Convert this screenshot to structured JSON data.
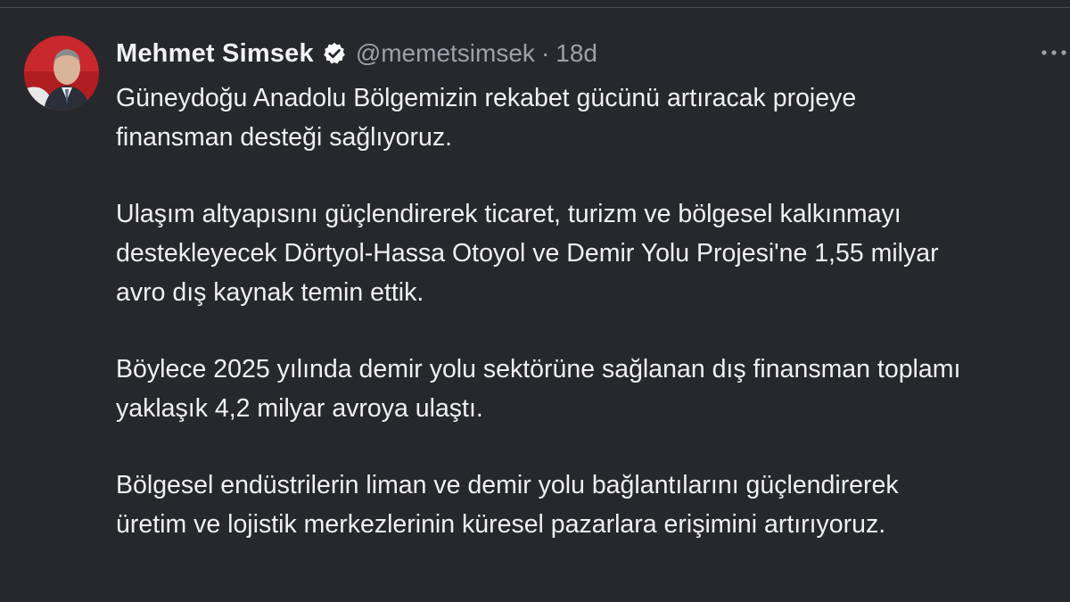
{
  "post": {
    "author": {
      "name": "Mehmet Simsek",
      "handle": "@memetsimsek",
      "verified_icon": "verified-badge-icon",
      "avatar": "avatar-photo"
    },
    "separator": "·",
    "time": "18d",
    "more_icon": "more-options-icon",
    "paragraphs": [
      {
        "lines": [
          "Güneydoğu Anadolu Bölgemizin rekabet gücünü artıracak projeye",
          "finansman desteği sağlıyoruz."
        ]
      },
      {
        "lines": [
          "Ulaşım altyapısını güçlendirerek ticaret, turizm ve bölgesel kalkınmayı",
          "destekleyecek Dörtyol-Hassa Otoyol ve Demir Yolu Projesi'ne 1,55 milyar",
          "avro dış kaynak temin ettik."
        ]
      },
      {
        "lines": [
          "Böylece 2025 yılında demir yolu sektörüne sağlanan dış finansman toplamı",
          "yaklaşık 4,2 milyar avroya ulaştı."
        ]
      },
      {
        "lines": [
          "Bölgesel endüstrilerin liman ve demir yolu bağlantılarını güçlendirerek",
          "üretim ve lojistik merkezlerinin küresel pazarlara erişimini artırıyoruz."
        ]
      }
    ]
  },
  "colors": {
    "background": "#27282c",
    "text": "#f0f0f0",
    "muted": "#9da1a8",
    "verified": "#ffffff"
  }
}
